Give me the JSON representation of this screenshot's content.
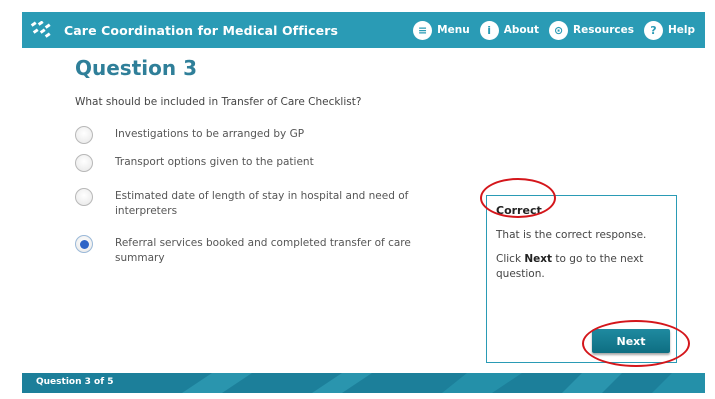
{
  "header": {
    "title": "Care Coordination for Medical Officers",
    "nav": [
      {
        "label": "Menu",
        "icon": "menu-icon",
        "glyph": "≡"
      },
      {
        "label": "About",
        "icon": "info-icon",
        "glyph": "i"
      },
      {
        "label": "Resources",
        "icon": "resources-icon",
        "glyph": "⊙"
      },
      {
        "label": "Help",
        "icon": "help-icon",
        "glyph": "?"
      }
    ]
  },
  "question": {
    "title": "Question 3",
    "text": "What should be included in Transfer of Care Checklist?",
    "options": [
      {
        "label": "Investigations to be arranged by GP",
        "selected": false
      },
      {
        "label": "Transport options given to the patient",
        "selected": false
      },
      {
        "label": "Estimated date of length of stay in hospital and need of interpreters",
        "selected": false
      },
      {
        "label": "Referral services booked and completed transfer of care summary",
        "selected": true
      }
    ]
  },
  "feedback": {
    "title": "Correct",
    "message": "That is the correct response.",
    "instruction_prefix": "Click ",
    "instruction_bold": "Next",
    "instruction_suffix": " to go to the next question.",
    "next_label": "Next"
  },
  "footer": {
    "progress": "Question 3 of 5"
  },
  "colors": {
    "header": "#2a9bb5",
    "title": "#2f7f99",
    "footer": "#1c7f9a",
    "radio_selected": "#2f64c7",
    "annotation": "#d4161b"
  }
}
